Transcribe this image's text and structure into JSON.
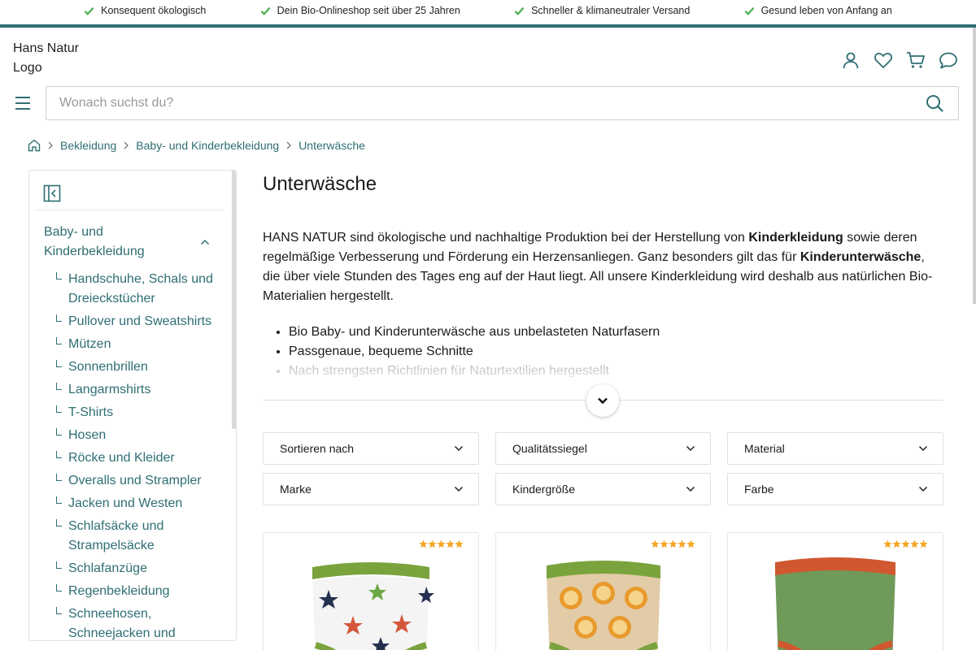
{
  "usp": [
    "Konsequent ökologisch",
    "Dein Bio-Onlineshop seit über 25 Jahren",
    "Schneller & klimaneutraler Versand",
    "Gesund leben von Anfang an"
  ],
  "logo": {
    "alt": "Hans Natur Logo"
  },
  "search": {
    "placeholder": "Wonach suchst du?"
  },
  "breadcrumb": [
    "Bekleidung",
    "Baby- und Kinderbekleidung",
    "Unterwäsche"
  ],
  "sidebar": {
    "parent": "Baby- und Kinderbekleidung",
    "items": [
      "Handschuhe, Schals und Dreieckstücher",
      "Pullover und Sweatshirts",
      "Mützen",
      "Sonnenbrillen",
      "Langarmshirts",
      "T-Shirts",
      "Hosen",
      "Röcke und Kleider",
      "Overalls und Strampler",
      "Jacken und Westen",
      "Schlafsäcke und Strampelsäcke",
      "Schlafanzüge",
      "Regenbekleidung",
      "Schneehosen, Schneejacken und"
    ]
  },
  "main": {
    "title": "Unterwäsche",
    "desc": {
      "p1": "HANS NATUR sind ökologische und nachhaltige Produktion bei der Herstellung von ",
      "b1": "Kinderkleidung",
      "p2": " sowie deren regelmäßige Verbesserung und Förderung ein Herzensanliegen. Ganz besonders gilt das für ",
      "b2": "Kinderunterwäsche",
      "p3": ", die über viele Stunden des Tages eng auf der Haut liegt. All unsere Kinderkleidung wird deshalb aus natürlichen Bio-Materialien hergestellt."
    },
    "bullets": [
      "Bio Baby- und Kinderunterwäsche aus unbelasteten Naturfasern",
      "Passgenaue, bequeme Schnitte",
      "Nach strengsten Richtlinien für Naturtextilien hergestellt"
    ]
  },
  "filters": [
    "Sortieren nach",
    "Qualitätssiegel",
    "Material",
    "Marke",
    "Kindergröße",
    "Farbe"
  ],
  "products": [
    {
      "rating": 5,
      "image": "star-print-underpants"
    },
    {
      "rating": 5,
      "image": "lion-print-underpants"
    },
    {
      "rating": 5,
      "image": "green-red-underpants"
    }
  ],
  "colors": {
    "accent": "#2e6e73",
    "check": "#4caf50",
    "star": "#f5a623"
  }
}
